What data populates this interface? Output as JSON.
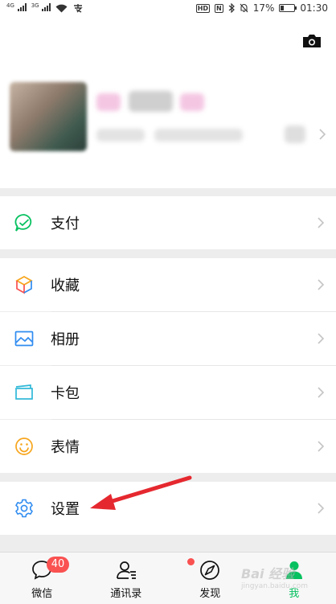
{
  "status_bar": {
    "net1": "4G",
    "net2": "3G",
    "carrier_icon": "alipay-icon",
    "hd": "HD",
    "nfc": "N",
    "battery": "17%",
    "time": "01:30"
  },
  "menu": {
    "pay": "支付",
    "favorites": "收藏",
    "album": "相册",
    "cards": "卡包",
    "stickers": "表情",
    "settings": "设置"
  },
  "tabs": [
    {
      "label": "微信",
      "badge": "40"
    },
    {
      "label": "通讯录"
    },
    {
      "label": "发现"
    },
    {
      "label": "我"
    }
  ],
  "watermark": {
    "brand": "Bai 经验",
    "url": "jingyan.baidu.com"
  },
  "colors": {
    "accent": "#07c160",
    "badge": "#fa5151",
    "arrow": "#e5282f"
  }
}
